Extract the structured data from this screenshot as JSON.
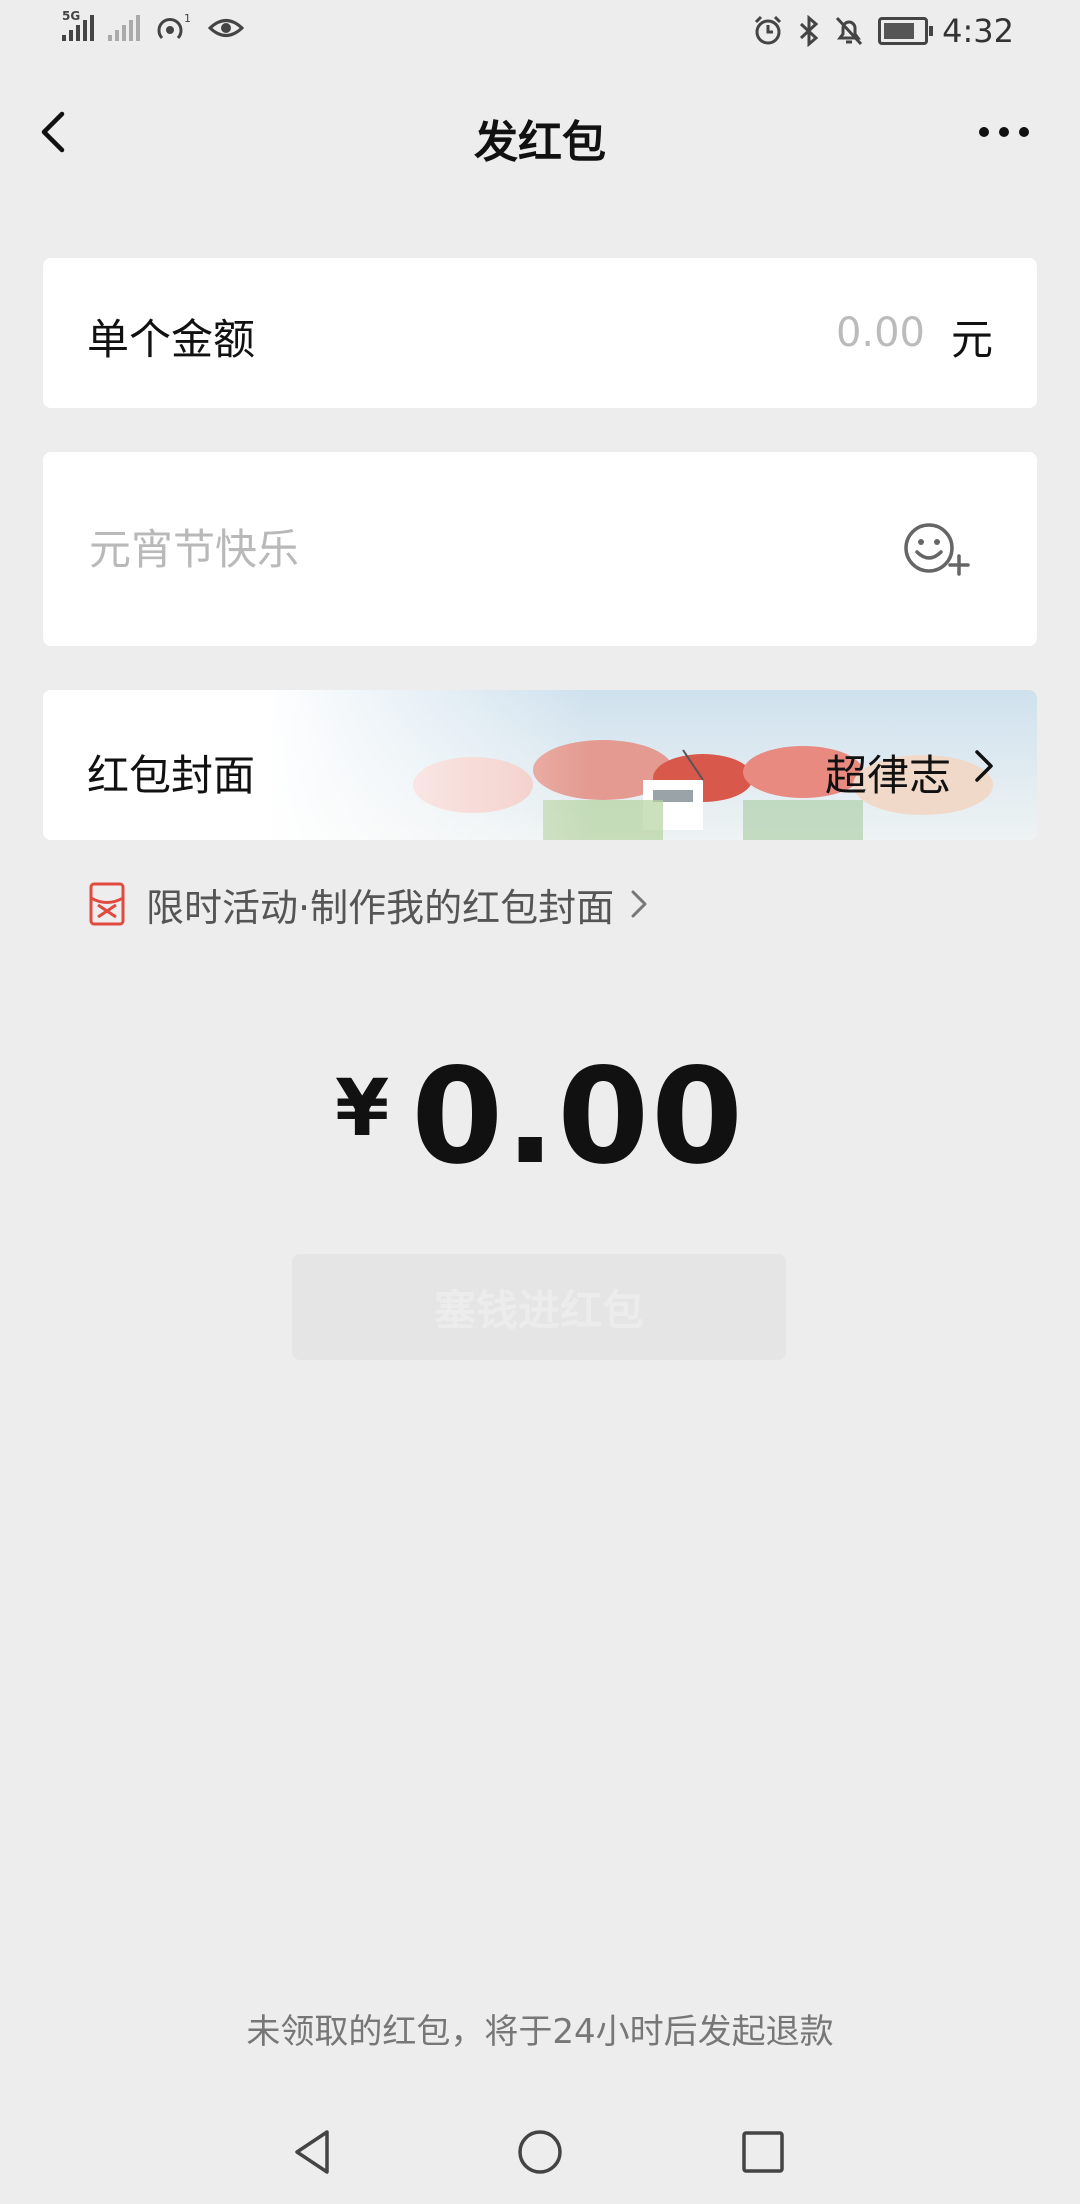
{
  "status_bar": {
    "signal_1_tag": "5G",
    "time": "4:32"
  },
  "nav": {
    "title": "发红包"
  },
  "amount": {
    "label": "单个金额",
    "placeholder": "0.00",
    "unit": "元"
  },
  "greeting": {
    "placeholder": "元宵节快乐"
  },
  "cover": {
    "label": "红包封面",
    "value": "超律志"
  },
  "promo": {
    "text": "限时活动·制作我的红包封面"
  },
  "total": {
    "currency": "¥",
    "value": "0.00"
  },
  "submit": {
    "label": "塞钱进红包"
  },
  "footer": {
    "note": "未领取的红包，将于24小时后发起退款"
  },
  "colors": {
    "background": "#ededed",
    "card": "#ffffff",
    "promo_icon": "#e04a3f",
    "disabled_button": "#e5e5e5"
  }
}
